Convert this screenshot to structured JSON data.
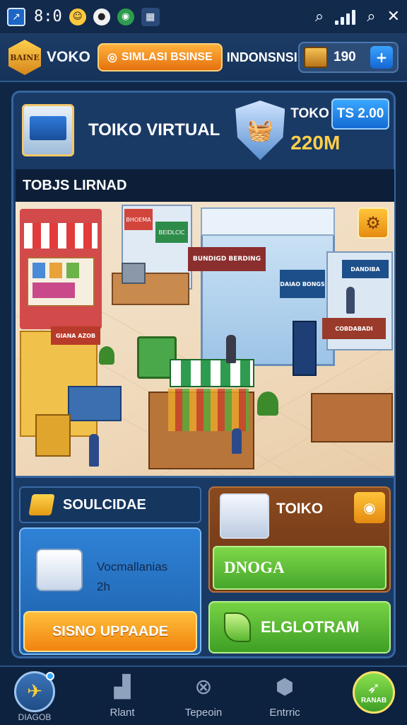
{
  "status_bar": {
    "time": "8:0",
    "icons": [
      "app-icon",
      "emoji-icon",
      "dot-icon",
      "globe-icon",
      "grid-icon",
      "search-icon",
      "wifi-icon",
      "signal-icon",
      "search-icon",
      "close-icon"
    ]
  },
  "header": {
    "logo_text": "BAINE",
    "name": "VOKO",
    "mode_button": "SIMLASI BSINSE",
    "subtitle": "INDONSNSI",
    "coins": "190",
    "add_label": "+"
  },
  "store": {
    "name": "TOIKO VIRTUAL",
    "stat_label": "TOKO",
    "stat_value": "220M",
    "price_button": "TS 2.00",
    "section_title": "TOBJS LIRNAD"
  },
  "scene_signs": [
    "BHOEMA",
    "BEIDLCIC",
    "BUNDIGD BERDING",
    "DAIAO BONGS",
    "DANDIBA",
    "COBDABADI",
    "GIANA AZOB"
  ],
  "upgrade": {
    "header": "SOULCIDAE",
    "description": "Vocmallanias",
    "number": "2h",
    "button": "SISNO UPPAADE"
  },
  "toko_card": {
    "label": "TOIKO",
    "panel_text": "DNOGA"
  },
  "program_button": "ELGLOTRAM",
  "bottom_nav": [
    {
      "label": "DIAGOB",
      "icon": "home-icon"
    },
    {
      "label": "Rlant",
      "icon": "chart-icon"
    },
    {
      "label": "Tepeoin",
      "icon": "compass-icon"
    },
    {
      "label": "Entrric",
      "icon": "box-icon"
    },
    {
      "label": "RANAB",
      "icon": "rocket-icon"
    }
  ],
  "colors": {
    "accent_orange": "#f1830f",
    "accent_green": "#45a62a",
    "accent_blue": "#1466d1",
    "panel_bg": "#1a3a66"
  }
}
